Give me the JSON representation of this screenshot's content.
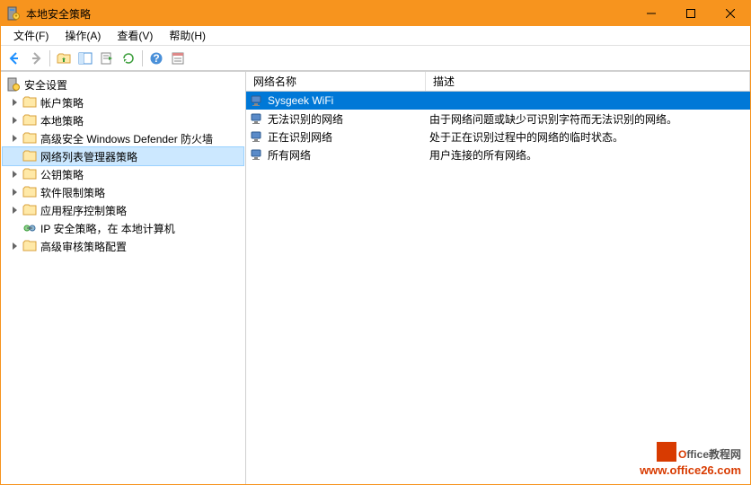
{
  "window": {
    "title": "本地安全策略"
  },
  "menubar": [
    "文件(F)",
    "操作(A)",
    "查看(V)",
    "帮助(H)"
  ],
  "tree": {
    "root": "安全设置",
    "items": [
      {
        "label": "帐户策略",
        "expandable": true
      },
      {
        "label": "本地策略",
        "expandable": true
      },
      {
        "label": "高级安全 Windows Defender 防火墙",
        "expandable": true
      },
      {
        "label": "网络列表管理器策略",
        "expandable": false,
        "selected": true
      },
      {
        "label": "公钥策略",
        "expandable": true
      },
      {
        "label": "软件限制策略",
        "expandable": true
      },
      {
        "label": "应用程序控制策略",
        "expandable": true
      },
      {
        "label": "IP 安全策略，在 本地计算机",
        "expandable": false,
        "ipsec": true
      },
      {
        "label": "高级审核策略配置",
        "expandable": true
      }
    ]
  },
  "list": {
    "columns": [
      "网络名称",
      "描述"
    ],
    "rows": [
      {
        "name": "Sysgeek WiFi",
        "desc": "",
        "selected": true
      },
      {
        "name": "无法识别的网络",
        "desc": "由于网络问题或缺少可识别字符而无法识别的网络。"
      },
      {
        "name": "正在识别网络",
        "desc": "处于正在识别过程中的网络的临时状态。"
      },
      {
        "name": "所有网络",
        "desc": "用户连接的所有网络。"
      }
    ]
  },
  "watermark": {
    "brand_o": "O",
    "brand_rest": "ffice教程网",
    "url": "www.office26.com"
  }
}
